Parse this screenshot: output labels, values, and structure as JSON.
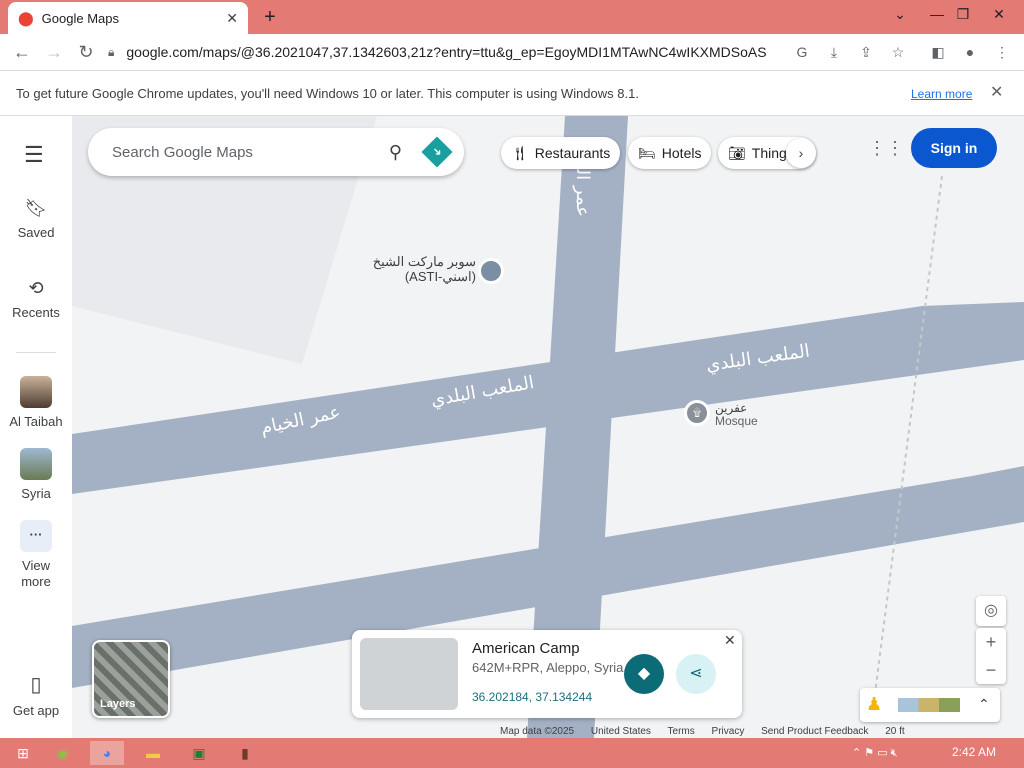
{
  "browser": {
    "tab_title": "Google Maps",
    "url": "google.com/maps/@36.2021047,37.1342603,21z?entry=ttu&g_ep=EgoyMDI1MTAwNC4wIKXMDSoAS...",
    "infobar_text": "To get future Google Chrome updates, you'll need Windows 10 or later. This computer is using Windows 8.1.",
    "learn_more": "Learn more"
  },
  "sidebar": {
    "items": [
      {
        "label": "Saved",
        "icon": "bookmark-icon"
      },
      {
        "label": "Recents",
        "icon": "history-icon"
      },
      {
        "label": "Al Taibah",
        "icon": "place-thumbnail"
      },
      {
        "label": "Syria",
        "icon": "place-thumbnail"
      },
      {
        "label": "View more",
        "icon": "more-icon"
      },
      {
        "label": "Get app",
        "icon": "phone-icon"
      }
    ]
  },
  "map": {
    "search_placeholder": "Search Google Maps",
    "chips": [
      "Restaurants",
      "Hotels",
      "Things"
    ],
    "sign_in": "Sign in",
    "layers": "Layers",
    "street_labels": {
      "left": "عمر الخيام",
      "middle": "الملعب البلدي",
      "right": "الملعب البلدي",
      "vertical": "عمر الخيام"
    },
    "poi_market_line1": "سوبر ماركت الشيخ",
    "poi_market_line2": "(ASTI-اسني)",
    "poi_mosque_name": "عفرين",
    "poi_mosque_type": "Mosque",
    "card": {
      "name": "American Camp",
      "address": "642M+RPR, Aleppo, Syria",
      "coords": "36.202184, 37.134244"
    },
    "footer": [
      "Map data ©2025",
      "United States",
      "Terms",
      "Privacy",
      "Send Product Feedback",
      "20 ft"
    ]
  },
  "taskbar": {
    "clock": "2:42 AM"
  },
  "colors": {
    "road": "#a4b1c4",
    "tabstrip": "#e37b74",
    "signin": "#0b57d0"
  }
}
